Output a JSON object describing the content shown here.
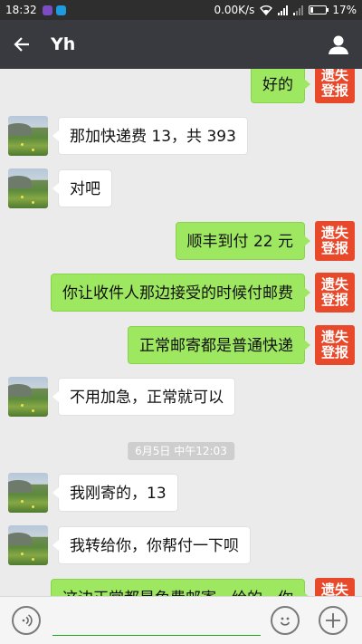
{
  "status_bar": {
    "time": "18:32",
    "speed": "0.00K/s",
    "battery": "17%",
    "battery_level": 0.17
  },
  "header": {
    "title": "Yh"
  },
  "messages": [
    {
      "side": "out",
      "text": "好的"
    },
    {
      "side": "in",
      "text": "那加快递费 13，共 393"
    },
    {
      "side": "in",
      "text": "对吧"
    },
    {
      "side": "out",
      "text": "顺丰到付 22 元"
    },
    {
      "side": "out",
      "text": "你让收件人那边接受的时候付邮费"
    },
    {
      "side": "out",
      "text": "正常邮寄都是普通快递"
    },
    {
      "side": "in",
      "text": "不用加急，正常就可以"
    },
    {
      "side": "in",
      "text": "我刚寄的，13"
    },
    {
      "side": "in",
      "text": "我转给你，你帮付一下呗"
    },
    {
      "side": "out",
      "text": "这边正常都是免费邮寄，给的，你"
    }
  ],
  "timestamp": "6月5日 中午12:03",
  "badge": {
    "line1": "遗失",
    "line2": "登报"
  },
  "input": {
    "placeholder": ""
  },
  "colors": {
    "accent_green": "#9ee760",
    "header_bg": "#393a3f",
    "badge_red": "#e8492b"
  }
}
